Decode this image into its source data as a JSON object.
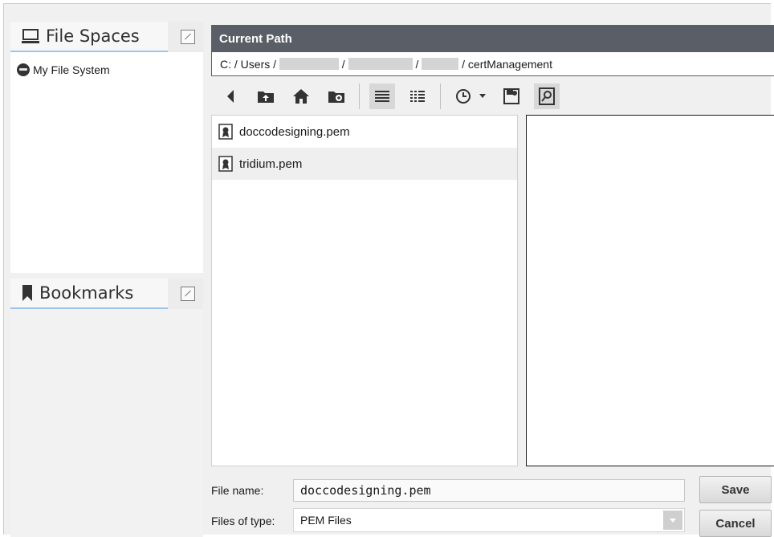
{
  "file_spaces": {
    "title": "File Spaces",
    "title_icon": "monitor-icon",
    "items": [
      {
        "label": "My File System",
        "icon": "disk-icon"
      }
    ]
  },
  "bookmarks": {
    "title": "Bookmarks",
    "title_icon": "bookmark-icon"
  },
  "path": {
    "header": "Current Path",
    "prefix": "C:",
    "segments": [
      "Users",
      "",
      "",
      "",
      "certManagement"
    ],
    "separator": " / "
  },
  "toolbar": {
    "buttons": [
      "back-icon",
      "up-folder-icon",
      "home-icon",
      "new-folder-icon",
      "list-view-icon",
      "details-view-icon",
      "history-icon",
      "history-dropdown-icon",
      "bookmark-add-icon",
      "preview-toggle-icon"
    ]
  },
  "files": [
    {
      "name": "doccodesigning.pem",
      "icon": "certificate-icon",
      "selected": false
    },
    {
      "name": "tridium.pem",
      "icon": "certificate-icon",
      "selected": true
    }
  ],
  "form": {
    "file_name_label": "File name:",
    "file_name_value": "doccodesigning.pem",
    "file_type_label": "Files of type:",
    "file_type_value": "PEM Files"
  },
  "buttons": {
    "save": "Save",
    "cancel": "Cancel"
  },
  "colors": {
    "path_header_bg": "#5a5f67",
    "tab_underline": "#9fc4ea",
    "selected_row_bg": "#efefef"
  }
}
